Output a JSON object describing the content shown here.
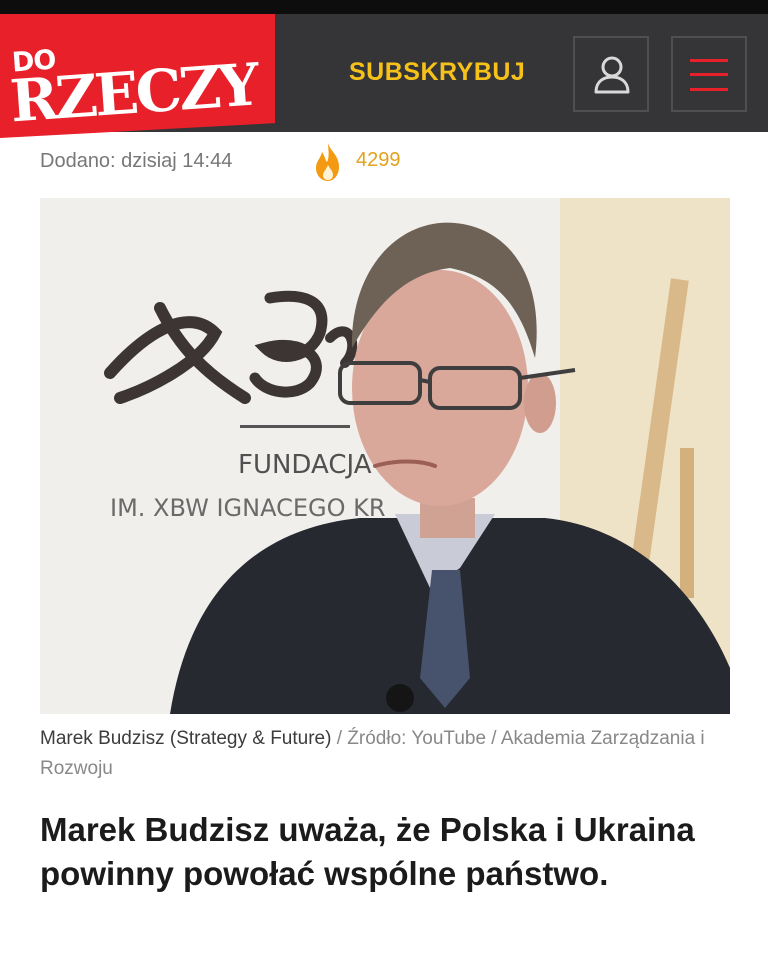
{
  "header": {
    "logo_line1": "DO",
    "logo_line2": "RZECZY",
    "subscribe_label": "SUBSKRYBUJ",
    "user_icon": "user-icon",
    "menu_icon": "hamburger-menu-icon",
    "accent_color": "#e8202a",
    "subscribe_color": "#f6c21a"
  },
  "article": {
    "added": "Dodano: dzisiaj 14:44",
    "views": "4299",
    "views_icon": "flame-icon",
    "photo": {
      "backdrop_line1": "FUNDACJA",
      "backdrop_line2": "IM. XBW IGNACEGO KR"
    },
    "caption": {
      "person": "Marek Budzisz (Strategy & Future)",
      "separator": "/",
      "source": "Źródło: YouTube",
      "separator2": "/",
      "credit": "Akademia Zarządzania i Rozwoju"
    },
    "headline": "Marek Budzisz uważa, że Polska i Ukraina powinny powołać wspólne państwo."
  }
}
